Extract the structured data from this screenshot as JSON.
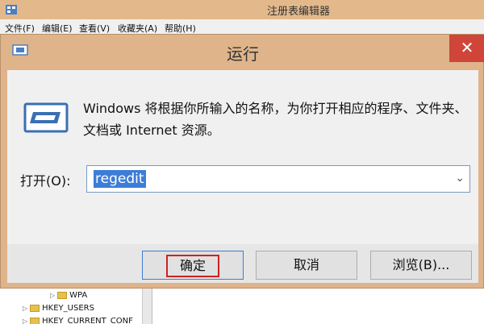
{
  "background_window": {
    "title": "注册表编辑器",
    "menu": [
      "文件(F)",
      "编辑(E)",
      "查看(V)",
      "收藏夹(A)",
      "帮助(H)"
    ],
    "tree": [
      "WPA",
      "HKEY_USERS",
      "HKEY_CURRENT_CONF"
    ]
  },
  "dialog": {
    "title": "运行",
    "close_glyph": "✕",
    "description": "Windows 将根据你所输入的名称，为你打开相应的程序、文件夹、文档或 Internet 资源。",
    "open_label": "打开(O):",
    "open_value": "regedit",
    "dropdown_glyph": "⌄",
    "buttons": {
      "ok": "确定",
      "cancel": "取消",
      "browse": "浏览(B)..."
    }
  }
}
